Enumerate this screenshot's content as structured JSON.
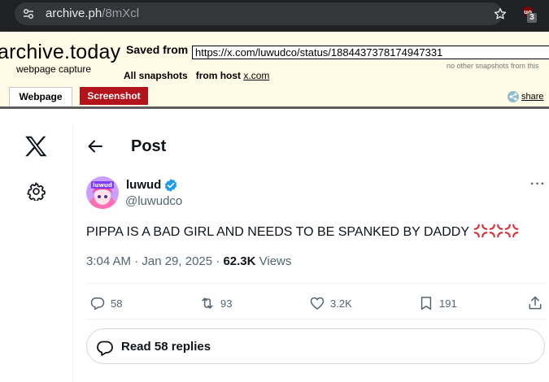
{
  "browser": {
    "url_host": "archive.ph",
    "url_path": "/8mXcl",
    "extension_badge": "3"
  },
  "archive": {
    "logo": "archive.today",
    "subtitle": "webpage capture",
    "saved_from_label": "Saved from",
    "saved_url": "https://x.com/luwudco/status/1884437378174947331",
    "no_other_snapshots": "no other snapshots from this",
    "all_snapshots_label": "All snapshots",
    "from_host_label": "from host",
    "host_link": "x.com",
    "tabs": [
      {
        "label": "Webpage"
      },
      {
        "label": "Screenshot"
      }
    ],
    "share_label": "share"
  },
  "post_page": {
    "header_title": "Post",
    "author": {
      "display_name": "luwud",
      "handle": "@luwudco"
    },
    "tweet_text": "PIPPA IS A BAD GIRL AND NEEDS TO BE SPANKED BY DADDY",
    "emoji": "anger-symbol-emoji",
    "timestamp": "3:04 AM · Jan 29, 2025 · ",
    "views_count": "62.3K",
    "views_label": " Views",
    "actions": {
      "replies": "58",
      "reposts": "93",
      "likes": "3.2K",
      "bookmarks": "191"
    },
    "read_replies_label": "Read 58 replies"
  },
  "colors": {
    "archive_bg": "#fffbe6",
    "screenshot_tab": "#b3141b",
    "verified_blue": "#1d9bf0",
    "secondary_text": "#536471",
    "anger_red": "#e02f3a"
  }
}
